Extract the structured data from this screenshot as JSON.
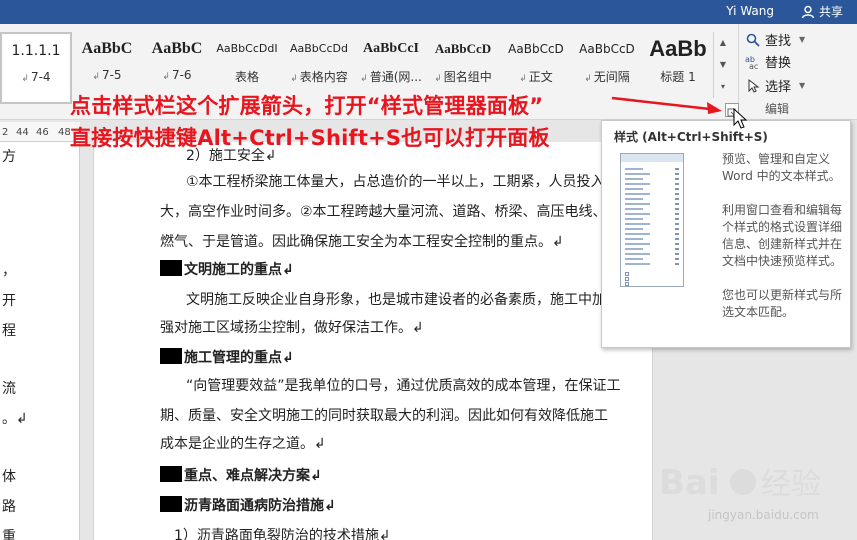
{
  "topbar": {
    "user": "Yi Wang",
    "share_label": "共享"
  },
  "styles_gallery": [
    {
      "sample": "1.1.1.1",
      "name": "7-4",
      "name_prefix": "↲",
      "selected": true
    },
    {
      "sample": "AaBbC",
      "name": "7-5",
      "name_prefix": "↲"
    },
    {
      "sample": "AaBbC",
      "name": "7-6",
      "name_prefix": "↲"
    },
    {
      "sample": "AaBbCcDdI",
      "name": "表格"
    },
    {
      "sample": "AaBbCcDd",
      "name": "表格内容",
      "name_prefix": "↲"
    },
    {
      "sample": "AaBbCcI",
      "name": "普通(网...",
      "name_prefix": "↲"
    },
    {
      "sample": "AaBbCcD",
      "name": "图名组中",
      "name_prefix": "↲"
    },
    {
      "sample": "AaBbCcD",
      "name": "正文",
      "name_prefix": "↲"
    },
    {
      "sample": "AaBbCcD",
      "name": "无间隔",
      "name_prefix": "↲"
    },
    {
      "sample": "AaBb",
      "name": "标题 1"
    }
  ],
  "editing": {
    "find": "查找",
    "replace": "替换",
    "select": "选择",
    "group_label": "编辑"
  },
  "annotation": {
    "line1": "点击样式栏这个扩展箭头，打开“样式管理器面板”",
    "line2": "直接按快捷键Alt+Ctrl+Shift+S也可以打开面板"
  },
  "ruler": {
    "marks": [
      "2",
      "44",
      "46",
      "48"
    ]
  },
  "left_page": {
    "chars": [
      "方",
      "，",
      "开",
      "程",
      "流",
      "。↲",
      "体",
      "路",
      "重"
    ]
  },
  "document": {
    "paragraphs": [
      {
        "type": "text",
        "text": "2）施工安全↲"
      },
      {
        "type": "text",
        "text": "①本工程桥梁施工体量大，占总造价的一半以上，工期紧，人员投入"
      },
      {
        "type": "text",
        "text": "大，高空作业时间多。②本工程跨越大量河流、道路、桥梁、高压电线、"
      },
      {
        "type": "text",
        "text": "燃气、于是管道。因此确保施工安全为本工程安全控制的重点。↲"
      },
      {
        "type": "heading",
        "text": "文明施工的重点↲"
      },
      {
        "type": "text",
        "text": "文明施工反映企业自身形象，也是城市建设者的必备素质，施工中加"
      },
      {
        "type": "text",
        "text": "强对施工区域扬尘控制，做好保洁工作。↲"
      },
      {
        "type": "heading",
        "text": "施工管理的重点↲"
      },
      {
        "type": "text",
        "text": "“向管理要效益”是我单位的口号，通过优质高效的成本管理，在保证工"
      },
      {
        "type": "text",
        "text": "期、质量、安全文明施工的同时获取最大的利润。因此如何有效降低施工"
      },
      {
        "type": "text",
        "text": "成本是企业的生存之道。↲"
      },
      {
        "type": "heading",
        "text": "重点、难点解决方案↲"
      },
      {
        "type": "heading",
        "text": "沥青路面通病防治措施↲"
      },
      {
        "type": "text",
        "text": "1）沥青路面龟裂防治的技术措施↲"
      }
    ]
  },
  "tooltip": {
    "title": "样式 (Alt+Ctrl+Shift+S)",
    "desc1": "预览、管理和自定义 Word 中的文本样式。",
    "desc2": "利用窗口查看和编辑每个样式的格式设置详细信息、创建新样式并在文档中快速预览样式。",
    "desc3": "您也可以更新样式与所选文本匹配。"
  },
  "watermark": {
    "brand": "Bai  经验",
    "url": "jingyan.baidu.com"
  },
  "colors": {
    "ribbon_blue": "#2b579a",
    "annotation_red": "#e8141e"
  }
}
